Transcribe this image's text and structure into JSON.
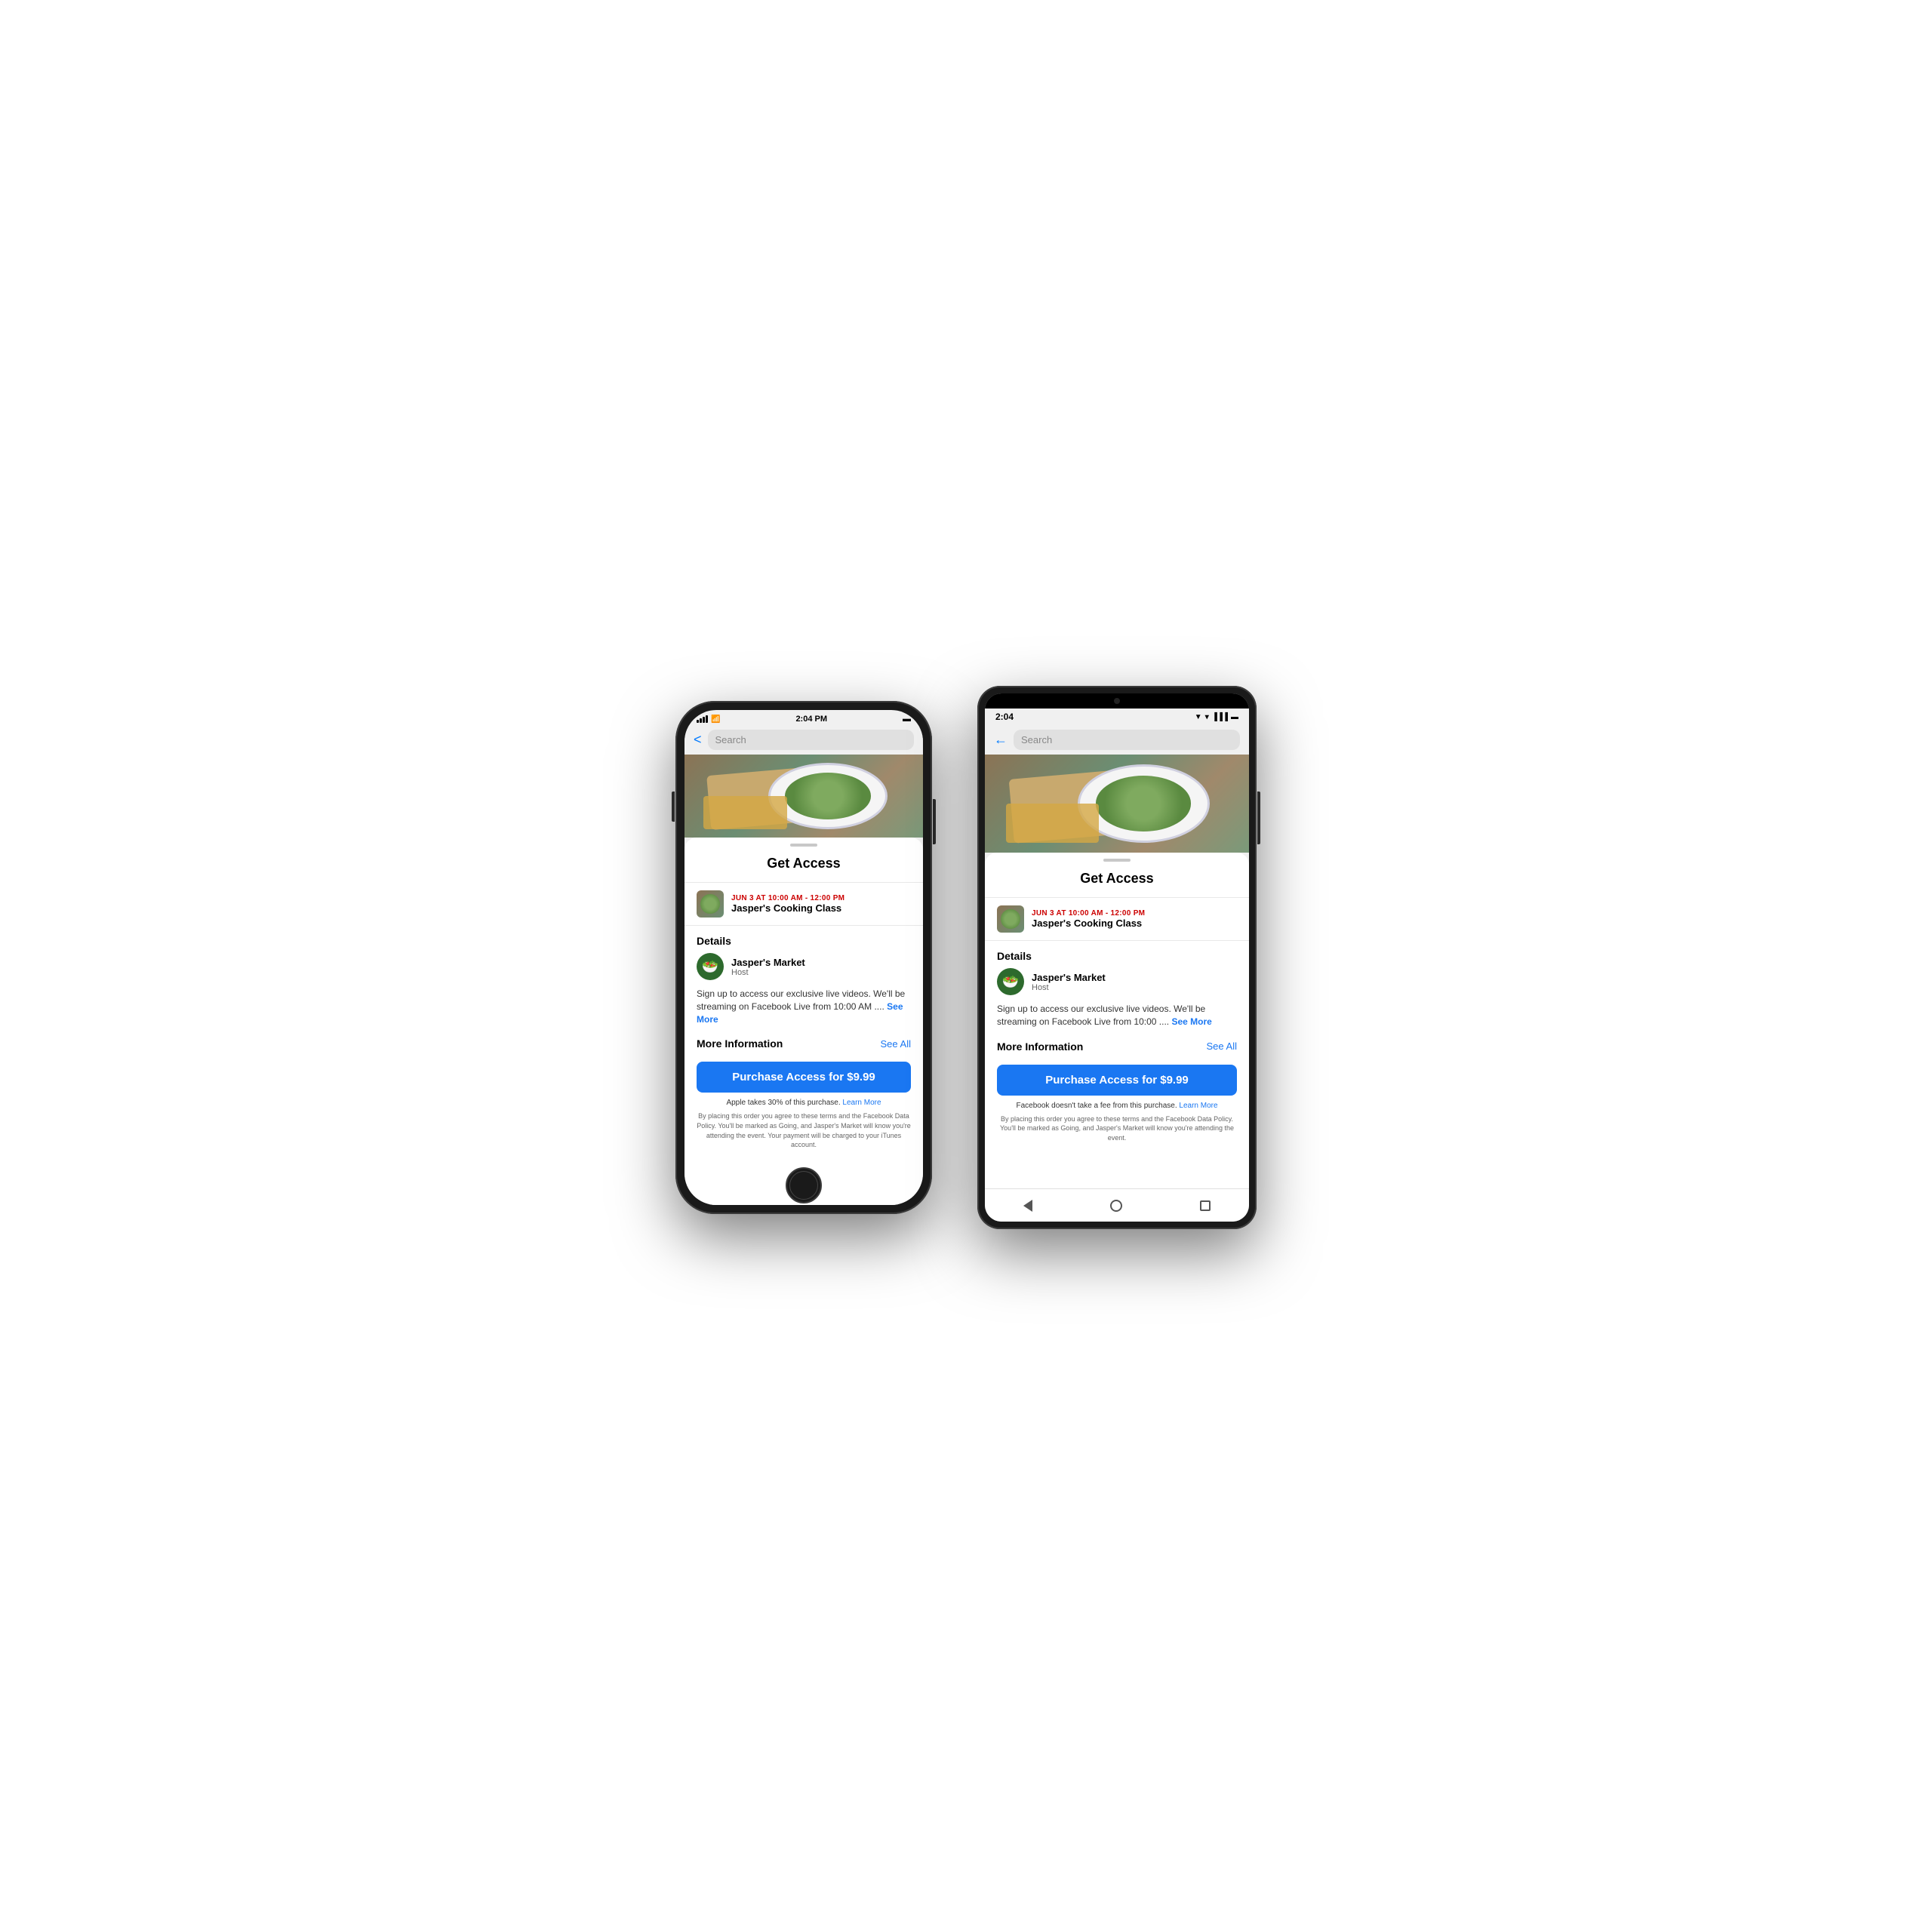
{
  "page": {
    "background": "#ffffff"
  },
  "iphone": {
    "status": {
      "time": "2:04 PM",
      "signal": "●●●●",
      "wifi": "wifi",
      "battery": "battery"
    },
    "search": {
      "placeholder": "Search",
      "back_label": "<"
    },
    "sheet": {
      "title": "Get Access",
      "event_date": "JUN 3 AT 10:00 AM - 12:00 PM",
      "event_name": "Jasper's Cooking Class",
      "details_label": "Details",
      "host_name": "Jasper's Market",
      "host_role": "Host",
      "description": "Sign up to access our exclusive live videos. We'll be streaming on Facebook Live from 10:00 AM ....",
      "see_more": "See More",
      "more_info_label": "More Information",
      "see_all": "See All",
      "purchase_btn": "Purchase Access for $9.99",
      "fee_note": "Apple takes 30% of this purchase.",
      "learn_more": "Learn More",
      "terms": "By placing this order you agree to these terms and the Facebook Data Policy. You'll be marked as Going, and Jasper's Market will know you're attending the event. Your payment will be charged to your iTunes account."
    }
  },
  "android": {
    "status": {
      "time": "2:04",
      "signal_wifi": "▼▲▌",
      "battery": "▐"
    },
    "search": {
      "placeholder": "Search",
      "back_label": "←"
    },
    "sheet": {
      "title": "Get Access",
      "event_date": "JUN 3 AT 10:00 AM - 12:00 PM",
      "event_name": "Jasper's Cooking Class",
      "details_label": "Details",
      "host_name": "Jasper's Market",
      "host_role": "Host",
      "description": "Sign up to access our exclusive live videos. We'll be streaming on Facebook Live from 10:00 ....",
      "see_more": "See More",
      "more_info_label": "More Information",
      "see_all": "See All",
      "purchase_btn": "Purchase Access for $9.99",
      "fee_note": "Facebook doesn't take a fee from this purchase.",
      "learn_more": "Learn More",
      "terms": "By placing this order you agree to these terms and the Facebook Data Policy. You'll be marked as Going, and Jasper's Market will know you're attending the event."
    }
  }
}
